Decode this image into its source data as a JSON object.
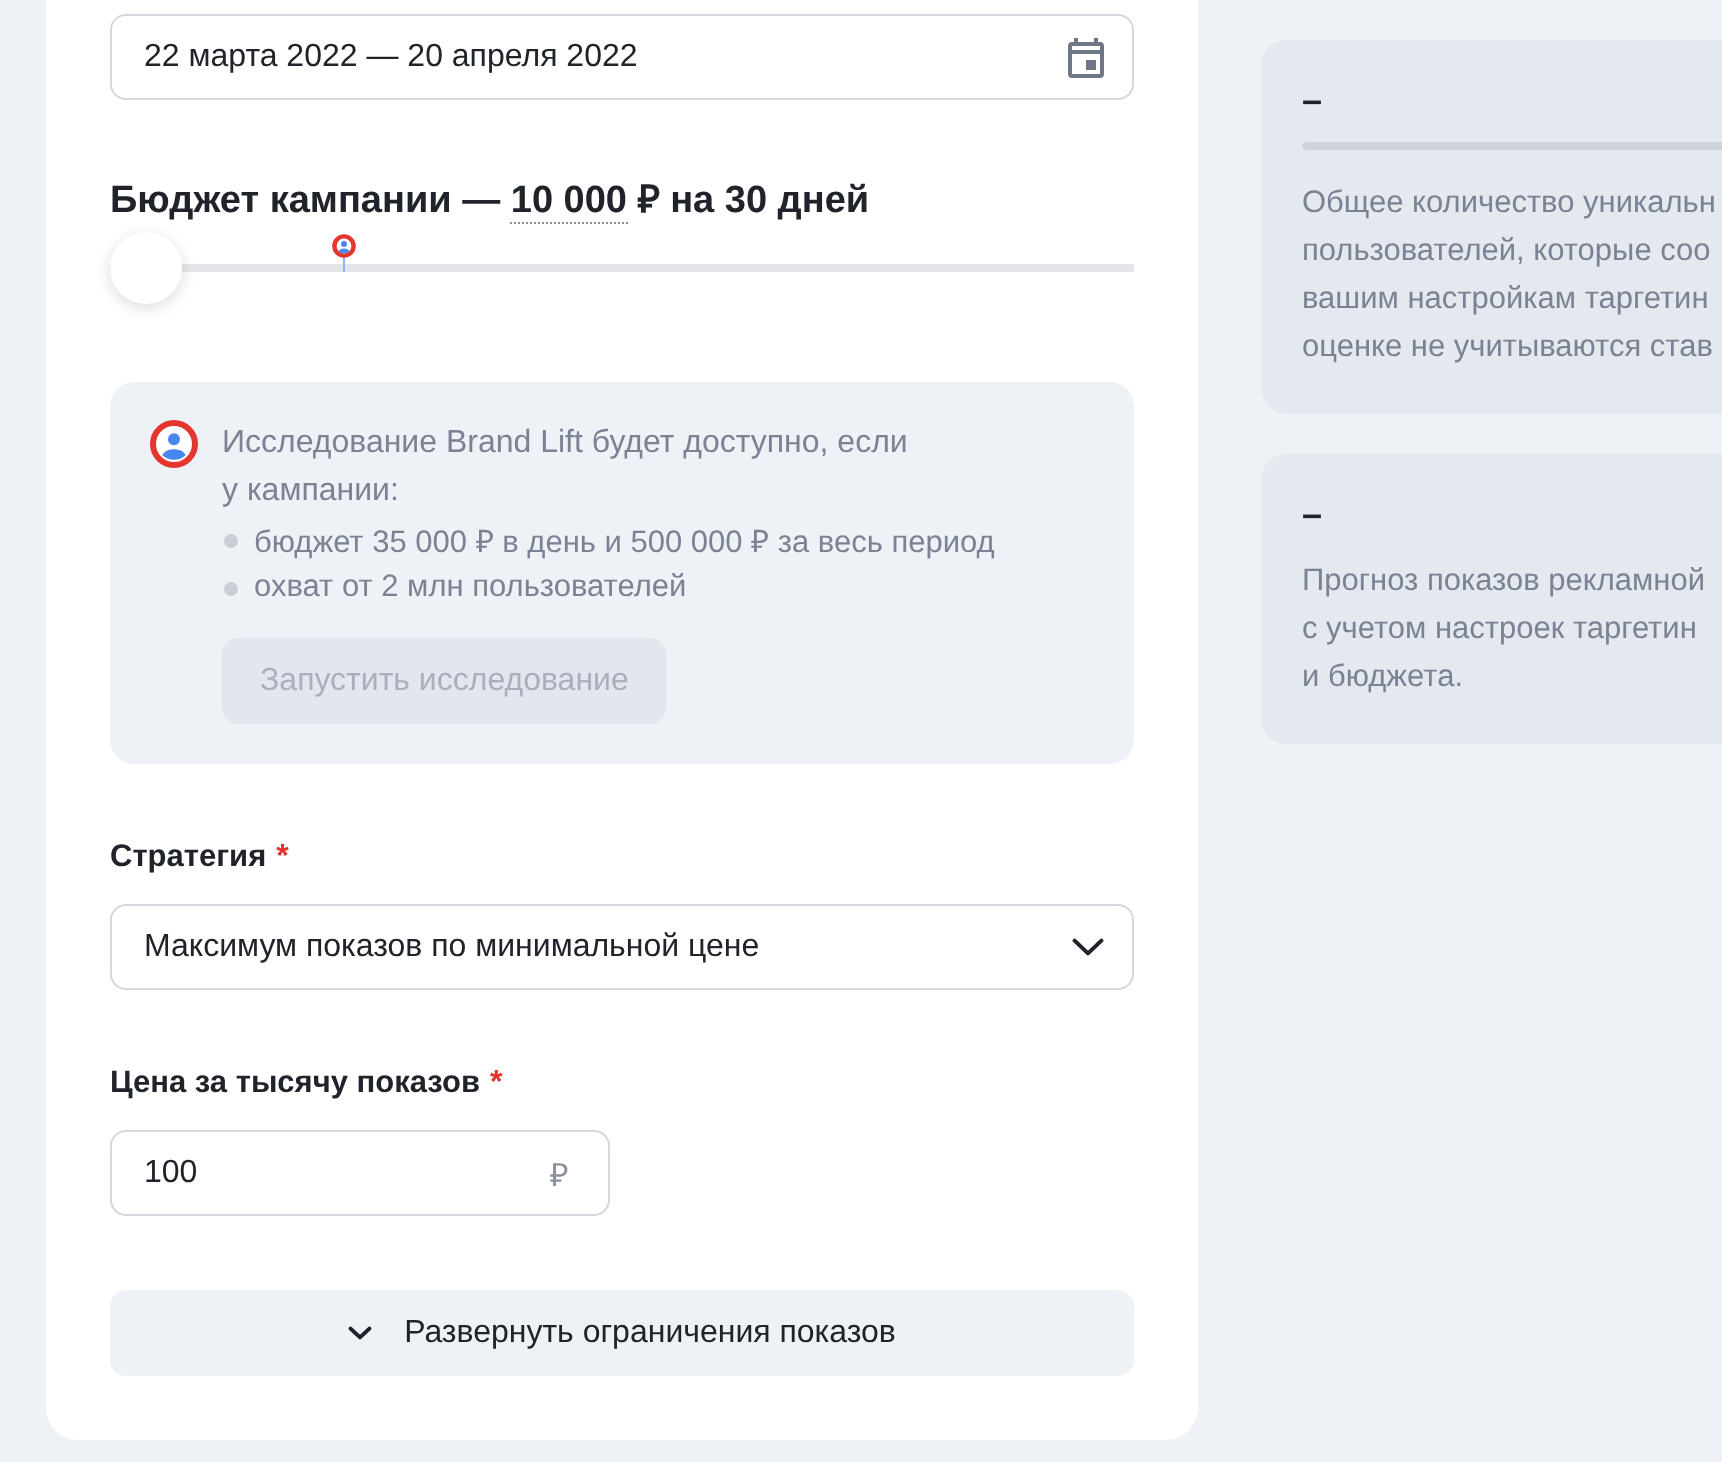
{
  "date_range": {
    "value": "22 марта 2022 — 20 апреля 2022"
  },
  "budget": {
    "title_prefix": "Бюджет кампании — ",
    "amount": "10 000",
    "title_suffix": " ₽ на 30 дней",
    "level": 0
  },
  "brand_lift": {
    "text": "Исследование Brand Lift будет доступно, если у кампании:",
    "conditions": [
      "бюджет 35 000 ₽ в день и 500 000 ₽ за весь период",
      "охват от 2 млн пользователей"
    ],
    "button": {
      "label": "Запустить исследование",
      "disabled": true
    }
  },
  "strategy": {
    "label": "Стратегия",
    "required_mark": "*",
    "value": "Максимум показов по минимальной цене"
  },
  "cpm": {
    "label": "Цена за тысячу показов",
    "required_mark": "*",
    "value": "100",
    "currency": "₽"
  },
  "expand_button": {
    "label": "Развернуть ограничения показов"
  },
  "forecast_cards": [
    {
      "kind": "meter",
      "value": "–",
      "lines": [
        "Общее количество уникальн",
        "пользователей, которые соо",
        "вашим настройкам таргетин",
        "оценке не учитываются став"
      ]
    },
    {
      "kind": "text",
      "value": "–",
      "lines": [
        "Прогноз показов рекламной",
        "с учетом настроек таргетин",
        "и бюджета."
      ]
    }
  ]
}
